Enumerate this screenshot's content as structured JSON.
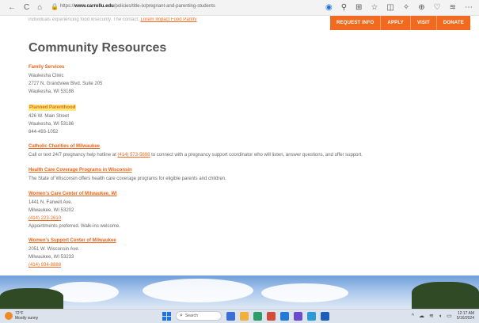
{
  "browser": {
    "url_prefix": "https://",
    "url_domain": "www.carrollu.edu",
    "url_path": "/policies/title-ix/pregnant-and-parenting-students",
    "nav_icons": [
      "←",
      "C",
      "⌂"
    ],
    "toolbar_icons": [
      "◉",
      "⚲",
      "⊞",
      "☆",
      "◫",
      "✧",
      "⊕",
      "♡",
      "≋",
      "⋯"
    ]
  },
  "topnav": {
    "items": [
      "REQUEST INFO",
      "APPLY",
      "VISIT",
      "DONATE"
    ],
    "bg_color": "#f26a1f"
  },
  "cutoff_text": {
    "text": "individuals experiencing food insecurity. The contact:",
    "link": "Lorem Impact Food Pantry"
  },
  "section": {
    "title": "Community Resources"
  },
  "resources": [
    {
      "name": "Family Services",
      "lines": [
        "Waukesha Clinic",
        "2727 N. Grandview Blvd. Suite 205",
        "Waukesha, WI 53188"
      ]
    },
    {
      "name": "Planned Parenthood",
      "highlighted": true,
      "lines": [
        "426 W. Main Street",
        "Waukesha, WI 53186",
        "844-493-1052"
      ]
    },
    {
      "name": "Catholic Charities of Milwaukee",
      "desc_prefix": "Call or text 24/7 pregnancy help hotline at",
      "desc_phone": "(414) 573-5698",
      "desc_suffix": "to connect with a pregnancy support coordinator who will listen, answer questions, and offer support."
    },
    {
      "name": "Health Care Coverage Programs in Wisconsin",
      "desc": "The State of Wisconsin offers health care coverage programs for eligible parents and children."
    },
    {
      "name": "Women's Care Center of Milwaukee, WI",
      "lines": [
        "1441 N. Farwell Ave.",
        "Milwaukee, WI 53202"
      ],
      "phone": "(414) 223-2610",
      "note": "Appointments preferred. Walk-ins welcome."
    },
    {
      "name": "Women's Support Center of Milwaukee",
      "lines": [
        "2051 W. Wisconsin Ave.",
        "Milwaukee, WI 53233"
      ],
      "phone": "(414) 934-8888"
    }
  ],
  "taskbar": {
    "weather_temp": "72°F",
    "weather_desc": "Mostly sunny",
    "search_label": "Search",
    "time": "12:17 AM",
    "date": "5/16/2024",
    "tray_icons": [
      "^",
      "☁",
      "≋",
      "◖",
      "▭"
    ]
  }
}
